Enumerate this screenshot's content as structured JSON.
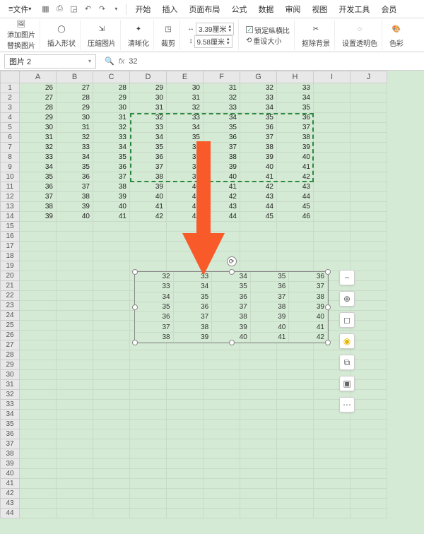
{
  "menubar": {
    "file": "文件",
    "tabs": [
      "开始",
      "插入",
      "页面布局",
      "公式",
      "数据",
      "审阅",
      "视图",
      "开发工具",
      "会员"
    ]
  },
  "qat": {
    "icons": [
      "save-icon",
      "undo-icon",
      "redo-icon",
      "print-icon",
      "preview-icon",
      "undo2-icon",
      "redo2-icon"
    ]
  },
  "ribbon": {
    "addpic": "添加图片",
    "replace": "替换图片",
    "insshape": "插入形状",
    "compress": "压缩图片",
    "sharpen": "清晰化",
    "crop": "裁剪",
    "width": "3.39厘米",
    "height": "9.58厘米",
    "lockratio": "锁定纵横比",
    "resetsize": "重设大小",
    "rembg": "抠除背景",
    "settrans": "设置透明色",
    "color": "色彩"
  },
  "fxbar": {
    "name": "图片 2",
    "fx": "fx",
    "value": "32"
  },
  "columns": [
    "A",
    "B",
    "C",
    "D",
    "E",
    "F",
    "G",
    "H",
    "I",
    "J"
  ],
  "rows": 44,
  "grid": [
    [
      26,
      27,
      28,
      29,
      30,
      31,
      32,
      33
    ],
    [
      27,
      28,
      29,
      30,
      31,
      32,
      33,
      34
    ],
    [
      28,
      29,
      30,
      31,
      32,
      33,
      34,
      35
    ],
    [
      29,
      30,
      31,
      32,
      33,
      34,
      35,
      36
    ],
    [
      30,
      31,
      32,
      33,
      34,
      35,
      36,
      37
    ],
    [
      31,
      32,
      33,
      34,
      35,
      36,
      37,
      38
    ],
    [
      32,
      33,
      34,
      35,
      36,
      37,
      38,
      39
    ],
    [
      33,
      34,
      35,
      36,
      37,
      38,
      39,
      40
    ],
    [
      34,
      35,
      36,
      37,
      38,
      39,
      40,
      41
    ],
    [
      35,
      36,
      37,
      38,
      39,
      40,
      41,
      42
    ],
    [
      36,
      37,
      38,
      39,
      40,
      41,
      42,
      43
    ],
    [
      37,
      38,
      39,
      40,
      41,
      42,
      43,
      44
    ],
    [
      38,
      39,
      40,
      41,
      42,
      43,
      44,
      45
    ],
    [
      39,
      40,
      41,
      42,
      43,
      44,
      45,
      46
    ]
  ],
  "pic_grid": [
    [
      32,
      33,
      34,
      35,
      36
    ],
    [
      33,
      34,
      35,
      36,
      37
    ],
    [
      34,
      35,
      36,
      37,
      38
    ],
    [
      35,
      36,
      37,
      38,
      39
    ],
    [
      36,
      37,
      38,
      39,
      40
    ],
    [
      37,
      38,
      39,
      40,
      41
    ],
    [
      38,
      39,
      40,
      41,
      42
    ]
  ],
  "float_tools": {
    "minus": "−",
    "zoom": "⊕",
    "crop": "◻",
    "bulb": "◉",
    "copy": "⧉",
    "snap": "▣",
    "more": "⋯"
  }
}
